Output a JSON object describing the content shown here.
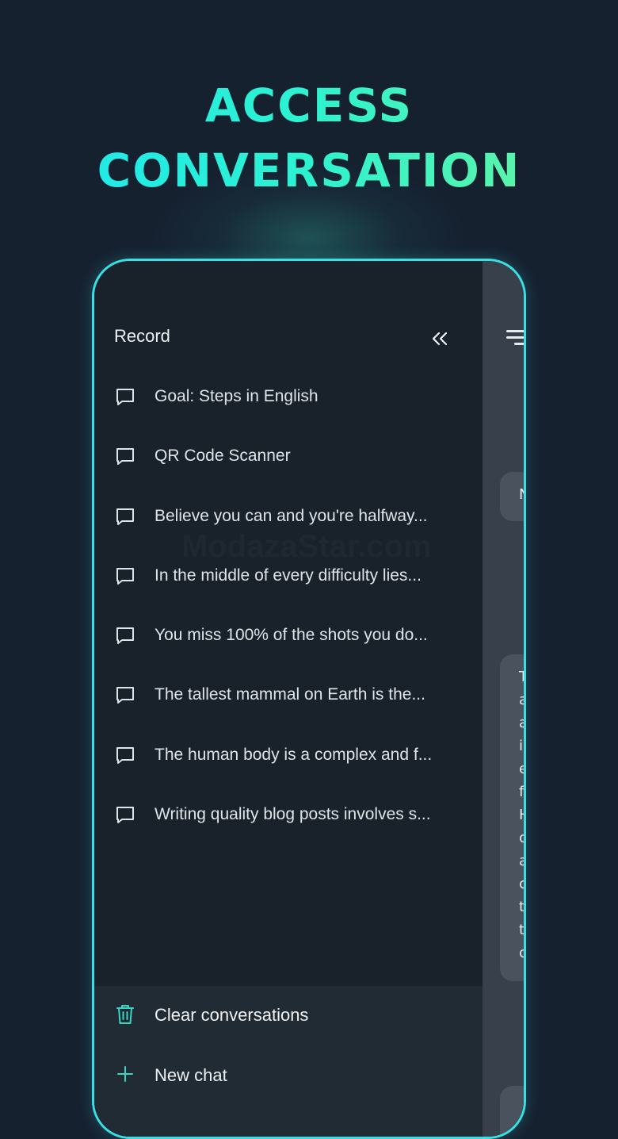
{
  "headline": {
    "line1": "ACCESS",
    "line2": "CONVERSATION"
  },
  "drawer": {
    "title": "Record",
    "collapse_icon": "double-chevron-left-icon",
    "items": [
      {
        "label": "Goal: Steps in English",
        "icon": "chat-bubble-icon"
      },
      {
        "label": "QR Code Scanner",
        "icon": "chat-bubble-icon"
      },
      {
        "label": "Believe you can and you're halfway...",
        "icon": "chat-bubble-icon"
      },
      {
        "label": "In the middle of every difficulty lies...",
        "icon": "chat-bubble-icon"
      },
      {
        "label": "You miss 100% of the shots you do...",
        "icon": "chat-bubble-icon"
      },
      {
        "label": "The tallest mammal on Earth is the...",
        "icon": "chat-bubble-icon"
      },
      {
        "label": "The human body is a complex and f...",
        "icon": "chat-bubble-icon"
      },
      {
        "label": "Writing quality blog posts involves s...",
        "icon": "chat-bubble-icon"
      }
    ],
    "footer": {
      "clear_label": "Clear conversations",
      "clear_icon": "trash-icon",
      "new_chat_label": "New chat",
      "new_chat_icon": "plus-icon"
    }
  },
  "watermark": "ModazaStar.com",
  "main_pane": {
    "menu_icon": "menu-icon",
    "bubble1_text": "N",
    "bubble2_chars": [
      "T",
      "a",
      "a",
      "i",
      "e",
      "f",
      "H",
      "c",
      "a",
      "c",
      "t",
      "t",
      "c"
    ]
  },
  "colors": {
    "background": "#162130",
    "accent": "#38e0e6",
    "drawer": "#19212a",
    "footer": "#212b34"
  }
}
